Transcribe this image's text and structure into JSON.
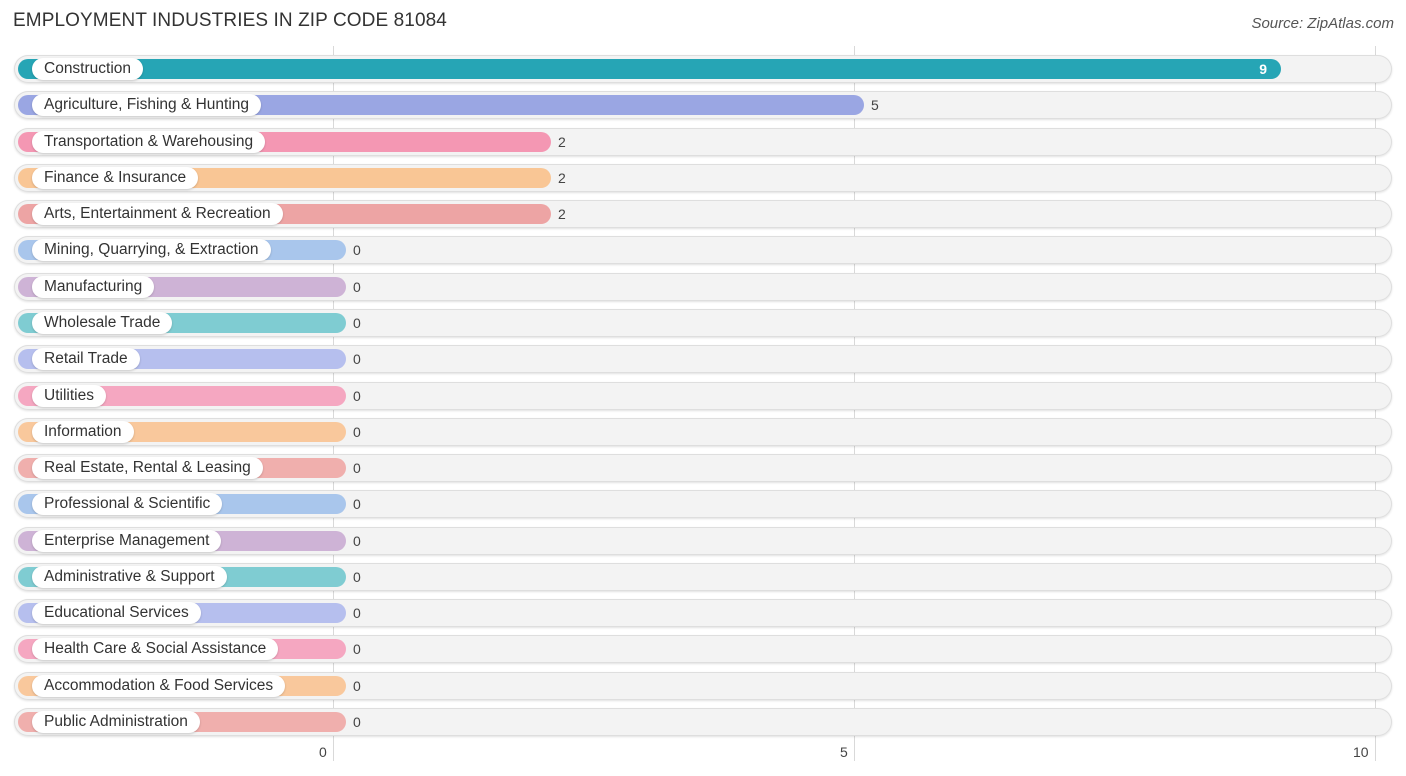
{
  "header": {
    "title": "EMPLOYMENT INDUSTRIES IN ZIP CODE 81084",
    "source": "Source: ZipAtlas.com"
  },
  "chart_data": {
    "type": "bar",
    "orientation": "horizontal",
    "title": "EMPLOYMENT INDUSTRIES IN ZIP CODE 81084",
    "xlabel": "",
    "ylabel": "",
    "xlim": [
      0,
      10
    ],
    "xticks": [
      "0",
      "5",
      "10"
    ],
    "grid": true,
    "categories": [
      "Construction",
      "Agriculture, Fishing & Hunting",
      "Transportation & Warehousing",
      "Finance & Insurance",
      "Arts, Entertainment & Recreation",
      "Mining, Quarrying, & Extraction",
      "Manufacturing",
      "Wholesale Trade",
      "Retail Trade",
      "Utilities",
      "Information",
      "Real Estate, Rental & Leasing",
      "Professional & Scientific",
      "Enterprise Management",
      "Administrative & Support",
      "Educational Services",
      "Health Care & Social Assistance",
      "Accommodation & Food Services",
      "Public Administration"
    ],
    "values": [
      9,
      5,
      2,
      2,
      2,
      0,
      0,
      0,
      0,
      0,
      0,
      0,
      0,
      0,
      0,
      0,
      0,
      0,
      0
    ],
    "value_labels": [
      "9",
      "5",
      "2",
      "2",
      "2",
      "0",
      "0",
      "0",
      "0",
      "0",
      "0",
      "0",
      "0",
      "0",
      "0",
      "0",
      "0",
      "0",
      "0"
    ],
    "colors": [
      "#26a5b5",
      "#9aa6e3",
      "#f497b3",
      "#f9c695",
      "#eda4a4",
      "#a9c6ec",
      "#ceb3d6",
      "#7fccd2",
      "#b6bfee",
      "#f5a7c1",
      "#f9c89c",
      "#f0afad",
      "#a9c6ec",
      "#ceb3d6",
      "#7fccd2",
      "#b6bfee",
      "#f5a7c1",
      "#f9c89c",
      "#f0afad"
    ]
  }
}
